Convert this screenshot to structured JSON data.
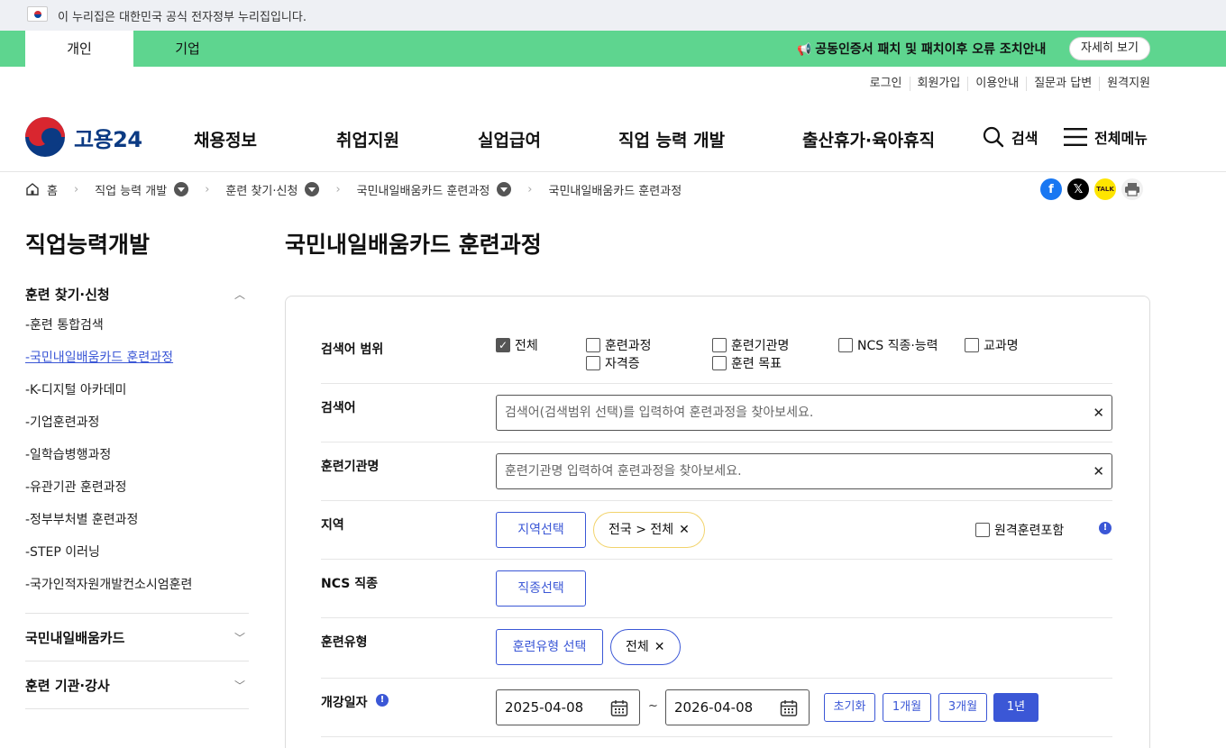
{
  "gov_banner": {
    "text": "이 누리집은 대한민국 공식 전자정부 누리집입니다."
  },
  "top_tabs": {
    "personal": "개인",
    "company": "기업"
  },
  "notice": {
    "text": "공동인증서 패치 및 패치이후 오류 조치안내",
    "button": "자세히 보기",
    "icon": "megaphone-icon"
  },
  "util_links": [
    "로그인",
    "회원가입",
    "이용안내",
    "질문과 답변",
    "원격지원"
  ],
  "logo": {
    "text": "고용24"
  },
  "gnb": [
    "채용정보",
    "취업지원",
    "실업급여",
    "직업 능력 개발",
    "출산휴가·육아휴직"
  ],
  "header_actions": {
    "search": "검색",
    "menu": "전체메뉴"
  },
  "breadcrumb": {
    "home": "홈",
    "items": [
      "직업 능력 개발",
      "훈련 찾기·신청",
      "국민내일배움카드 훈련과정",
      "국민내일배움카드 훈련과정"
    ]
  },
  "share": {
    "kakao_label": "TALK"
  },
  "lnb": {
    "title": "직업능력개발",
    "section1": "훈련 찾기·신청",
    "items": [
      "-훈련 통합검색",
      "-국민내일배움카드 훈련과정",
      "-K-디지털 아카데미",
      "-기업훈련과정",
      "-일학습병행과정",
      "-유관기관 훈련과정",
      "-정부부처별 훈련과정",
      "-STEP 이러닝",
      "-국가인적자원개발컨소시엄훈련"
    ],
    "section2": "국민내일배움카드",
    "section3": "훈련 기관·강사"
  },
  "main": {
    "title": "국민내일배움카드 훈련과정",
    "scope": {
      "label": "검색어 범위",
      "options": [
        "전체",
        "훈련과정",
        "훈련기관명",
        "NCS 직종·능력",
        "교과명",
        "자격증",
        "훈련 목표"
      ],
      "checked": "전체"
    },
    "keyword": {
      "label": "검색어",
      "placeholder": "검색어(검색범위 선택)를 입력하여 훈련과정을 찾아보세요."
    },
    "institution": {
      "label": "훈련기관명",
      "placeholder": "훈련기관명 입력하여 훈련과정을 찾아보세요."
    },
    "region": {
      "label": "지역",
      "button": "지역선택",
      "chip": "전국 > 전체",
      "remote": "원격훈련포함"
    },
    "ncs": {
      "label": "NCS 직종",
      "button": "직종선택"
    },
    "type": {
      "label": "훈련유형",
      "button": "훈련유형 선택",
      "chip": "전체"
    },
    "date": {
      "label": "개강일자",
      "start": "2025-04-08",
      "sep": "~",
      "end": "2026-04-08",
      "presets": [
        "초기화",
        "1개월",
        "3개월",
        "1년"
      ],
      "active_preset": "1년"
    }
  },
  "colors": {
    "green_bar": "#5ed58f",
    "accent_blue": "#3b57d6",
    "brand_navy": "#0b3a83",
    "brand_red": "#d9262f"
  }
}
